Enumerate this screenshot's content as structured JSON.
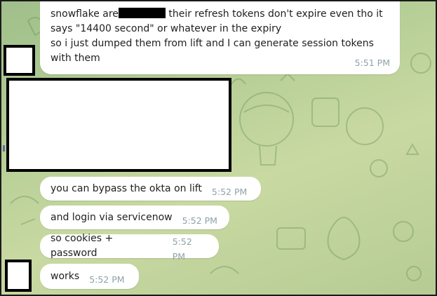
{
  "chat": {
    "messages": [
      {
        "line1_before": "snowflake are",
        "line1_after": " their refresh tokens don't expire even tho it",
        "line2": "says \"14400 second\" or whatever in the expiry",
        "line3": "so i just dumped them from lift and I can generate session tokens",
        "line4": "with them",
        "time": "5:51 PM"
      },
      {
        "text": "you can bypass the okta on lift",
        "time": "5:52 PM"
      },
      {
        "text": "and login via servicenow",
        "time": "5:52 PM"
      },
      {
        "text": "so cookies + password",
        "time": "5:52 PM"
      },
      {
        "text": "works",
        "time": "5:52 PM"
      }
    ]
  },
  "colors": {
    "bubble": "#ffffff",
    "timestamp": "#8ea2a8",
    "background": "#b6cf96"
  }
}
